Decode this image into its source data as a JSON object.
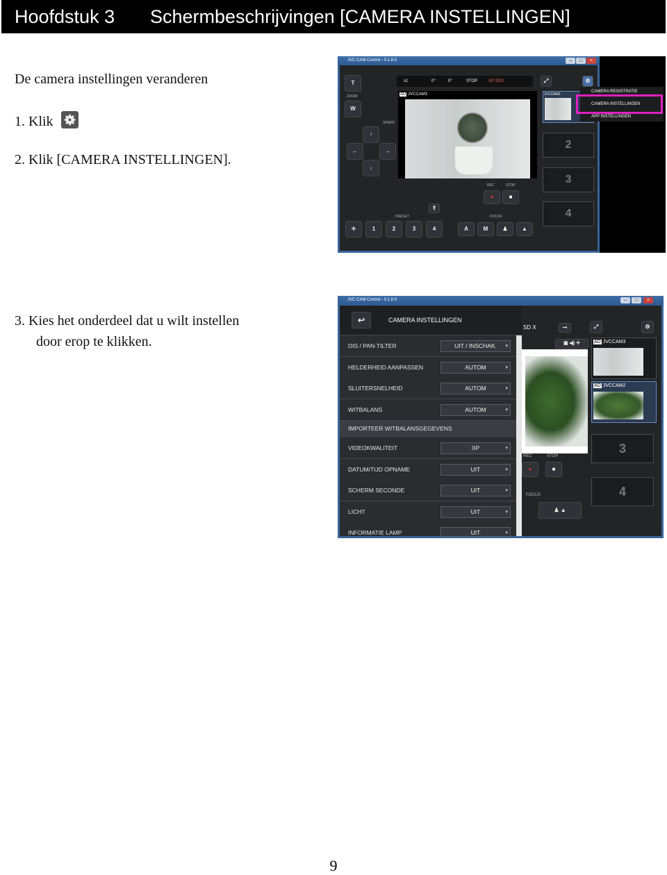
{
  "header": {
    "chapter": "Hoofdstuk 3",
    "title": "Schermbeschrijvingen [CAMERA INSTELLINGEN]"
  },
  "section_title": "De camera instellingen veranderen",
  "steps": {
    "step1": "1.  Klik",
    "step2": "2.  Klik [CAMERA INSTELLINGEN].",
    "step3_line1": "3.  Kies het onderdeel dat u wilt instellen",
    "step3_line2": "door erop te klikken."
  },
  "page_number": "9",
  "screenshot1": {
    "window_title": "JVC CAM Control - 0.1.8.0",
    "zoom_t": "T",
    "zoom_label": "ZOOM",
    "zoom_w": "W",
    "speed_label": "SPEED",
    "status_zoom": "x1",
    "status_pan": "0°",
    "status_tilt": "0°",
    "status_stop": "STOP",
    "status_media": "XP SDX",
    "camera_badge": "AD",
    "camera_name": "JVCCAM3",
    "thumb_camera_name": "JVCCAM3",
    "menu": [
      "CAMERA REGISTRATIE",
      "CAMERA INSTELLINGEN",
      "APP INSTELLINGEN"
    ],
    "thumbs": [
      "2",
      "3",
      "4"
    ],
    "rec_label": "REC",
    "stop_label": "STOP",
    "preset_label": "PRESET",
    "presets": [
      "1",
      "2",
      "3",
      "4"
    ],
    "focus_label": "FOCUS",
    "focus_a": "A",
    "focus_m": "M",
    "highlight_color": "#e020c0"
  },
  "screenshot2": {
    "window_title": "JVC CAM Control - 0.1.8.0",
    "panel_title": "CAMERA INSTELLINGEN",
    "rows": [
      {
        "name": "DIS / PAN-TILTER",
        "value": "UIT / INSCHAK."
      },
      {
        "name": "HELDERHEID AANPASSEN",
        "value": "AUTOM"
      },
      {
        "name": "SLUITERSNELHEID",
        "value": "AUTOM"
      },
      {
        "name": "WITBALANS",
        "value": "AUTOM"
      },
      {
        "name": "IMPORTEER WITBALANSGEGEVENS",
        "value": ""
      },
      {
        "name": "VIDEOKWALITEIT",
        "value": "XP"
      },
      {
        "name": "DATUM/TIJD OPNAME",
        "value": "UIT"
      },
      {
        "name": "SCHERM SECONDE",
        "value": "UIT"
      },
      {
        "name": "LICHT",
        "value": "UIT"
      },
      {
        "name": "INFORMATIE LAMP",
        "value": "UIT"
      }
    ],
    "media": "SD X",
    "cam3_badge": "AD",
    "cam3_name": "JVCCAM3",
    "cam2_badge": "AD",
    "cam2_name": "JVCCAM2",
    "thumbs": [
      "3",
      "4"
    ],
    "rec_label": "REC",
    "stop_label": "STOP",
    "focus_label": "FOCUS"
  }
}
